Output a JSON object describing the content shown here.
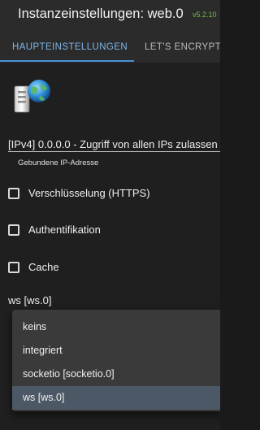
{
  "window": {
    "title": "Instanzeinstellungen: web.0",
    "version": "v5.2.10"
  },
  "tabs": [
    {
      "label": "HAUPTEINSTELLUNGEN",
      "active": true
    },
    {
      "label": "LET'S ENCRYPT",
      "active": false
    }
  ],
  "logo": {
    "icon": "web-adapter-logo-icon"
  },
  "bind_ip": {
    "value": "[IPv4] 0.0.0.0 - Zugriff von allen IPs zulassen",
    "label": "Gebundene IP-Adresse"
  },
  "options": [
    {
      "label": "Verschlüsselung (HTTPS)",
      "checked": false
    },
    {
      "label": "Authentifikation",
      "checked": false
    },
    {
      "label": "Cache",
      "checked": false
    }
  ],
  "socket_select": {
    "value": "ws [ws.0]",
    "options": [
      "keins",
      "integriert",
      "socketio [socketio.0]",
      "ws [ws.0]"
    ],
    "selected_index": 3
  },
  "colors": {
    "accent": "#4a90d9",
    "version": "#6fbf3a",
    "background": "#1f1f1f",
    "menu": "#3a3a3a"
  }
}
